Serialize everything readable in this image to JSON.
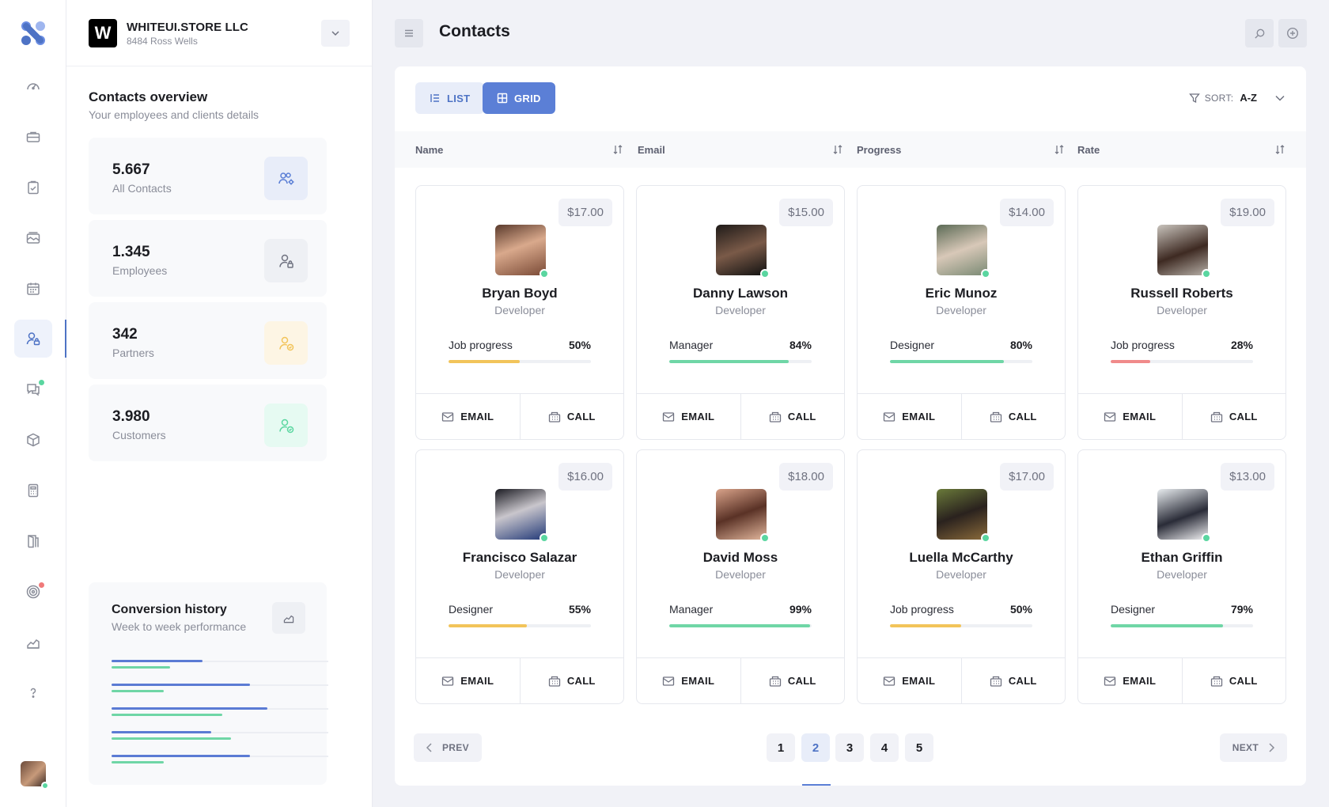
{
  "company": {
    "initial": "W",
    "name": "WHITEUI.STORE LLC",
    "address": "8484 Ross Wells"
  },
  "overview": {
    "title": "Contacts overview",
    "subtitle": "Your employees and clients details",
    "stats": [
      {
        "value": "5.667",
        "label": "All Contacts",
        "icon": "users-gear-icon",
        "color": "#5b7fd6",
        "bg": "#e8edf9"
      },
      {
        "value": "1.345",
        "label": "Employees",
        "icon": "user-lock-icon",
        "color": "#6f7280",
        "bg": "#eef0f4"
      },
      {
        "value": "342",
        "label": "Partners",
        "icon": "user-check-icon",
        "color": "#f2c45a",
        "bg": "#fdf5e4"
      },
      {
        "value": "3.980",
        "label": "Customers",
        "icon": "user-check-icon",
        "color": "#5ad6a0",
        "bg": "#e6faf2"
      }
    ]
  },
  "conversion": {
    "title": "Conversion history",
    "subtitle": "Week to week performance",
    "rows": [
      {
        "a": 0.42,
        "b": 0.27
      },
      {
        "a": 0.64,
        "b": 0.24
      },
      {
        "a": 0.72,
        "b": 0.51
      },
      {
        "a": 0.46,
        "b": 0.55
      },
      {
        "a": 0.64,
        "b": 0.24
      }
    ]
  },
  "header": {
    "title": "Contacts"
  },
  "view": {
    "list_label": "LIST",
    "grid_label": "GRID",
    "sort_key": "SORT:",
    "sort_value": "A-Z"
  },
  "columns": [
    "Name",
    "Email",
    "Progress",
    "Rate"
  ],
  "contacts": [
    {
      "rate": "$17.00",
      "name": "Bryan Boyd",
      "role": "Developer",
      "progress_label": "Job progress",
      "progress_text": "50%",
      "progress": 0.5,
      "bar_color": "#f2c45a",
      "avatar": "linear-gradient(160deg,#5a3a2c,#d9a98c 45%,#7a4a36)"
    },
    {
      "rate": "$15.00",
      "name": "Danny Lawson",
      "role": "Developer",
      "progress_label": "Manager",
      "progress_text": "84%",
      "progress": 0.84,
      "bar_color": "#6fd6a6",
      "avatar": "linear-gradient(160deg,#1e1a18,#7a5a48 50%,#111)"
    },
    {
      "rate": "$14.00",
      "name": "Eric Munoz",
      "role": "Developer",
      "progress_label": "Designer",
      "progress_text": "80%",
      "progress": 0.8,
      "bar_color": "#6fd6a6",
      "avatar": "linear-gradient(160deg,#5b6a55,#d8c8b8 50%,#7a8a74)"
    },
    {
      "rate": "$19.00",
      "name": "Russell Roberts",
      "role": "Developer",
      "progress_label": "Job progress",
      "progress_text": "28%",
      "progress": 0.28,
      "bar_color": "#f08a8a",
      "avatar": "linear-gradient(160deg,#c9c4bd,#3e2a22 55%,#b7b0a8)"
    },
    {
      "rate": "$16.00",
      "name": "Francisco Salazar",
      "role": "Developer",
      "progress_label": "Designer",
      "progress_text": "55%",
      "progress": 0.55,
      "bar_color": "#f2c45a",
      "avatar": "linear-gradient(160deg,#1b1b22,#c9c6cc 45%,#233a78)"
    },
    {
      "rate": "$18.00",
      "name": "David Moss",
      "role": "Developer",
      "progress_label": "Manager",
      "progress_text": "99%",
      "progress": 0.99,
      "bar_color": "#6fd6a6",
      "avatar": "linear-gradient(160deg,#d9a38a,#5a3226 50%,#e2b69c)"
    },
    {
      "rate": "$17.00",
      "name": "Luella McCarthy",
      "role": "Developer",
      "progress_label": "Job progress",
      "progress_text": "50%",
      "progress": 0.5,
      "bar_color": "#f2c45a",
      "avatar": "linear-gradient(160deg,#6a7a3a,#2a221e 50%,#8a6a3a)"
    },
    {
      "rate": "$13.00",
      "name": "Ethan Griffin",
      "role": "Developer",
      "progress_label": "Designer",
      "progress_text": "79%",
      "progress": 0.79,
      "bar_color": "#6fd6a6",
      "avatar": "linear-gradient(160deg,#e8ecef,#2a2c38 55%,#f2f2f4)"
    }
  ],
  "actions": {
    "email": "EMAIL",
    "call": "CALL"
  },
  "pagination": {
    "prev": "PREV",
    "next": "NEXT",
    "pages": [
      "1",
      "2",
      "3",
      "4",
      "5"
    ],
    "current": "2"
  }
}
